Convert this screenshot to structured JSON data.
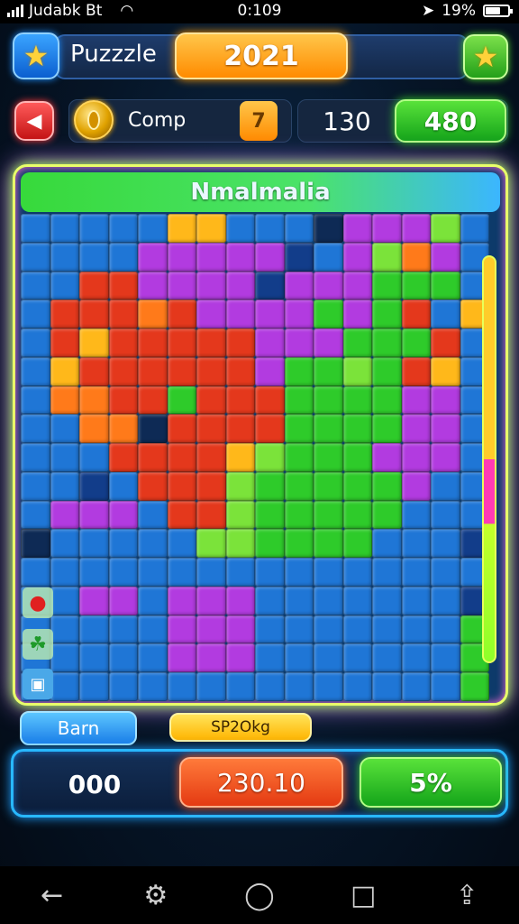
{
  "status": {
    "carrier": "Judabk Bt",
    "time": "0:109",
    "battery": "19%"
  },
  "header": {
    "title": "Puzzzle",
    "year": "2021"
  },
  "info": {
    "label": "Comp",
    "level": "7",
    "count": "130",
    "score": "480"
  },
  "board": {
    "title": "Nmalmalia",
    "palette": {
      "b": "#1f76d6",
      "d": "#123d8a",
      "p": "#b23be0",
      "r": "#e4381c",
      "o": "#ff7a1a",
      "y": "#ffb81a",
      "g": "#2ecb2a",
      "l": "#7be33a",
      "c": "#2aa7ff",
      "k": "#0e2a55"
    },
    "rows": [
      "bbbbbyybbbkppplb",
      "bbbbpppppdbplopb",
      "bbrrppppdpppgggb",
      "brrrorppppgpgrby",
      "bryrrrrrpppgggrb",
      "byrrrrrrpgglgryb",
      "boorrgrrrggggppb",
      "bbookrrrrggggppb",
      "bbbrrrrylgggpppb",
      "bbdbrrrlgggggpbb",
      "bpppbrrlgggggbbb",
      "kbbbbbllggggbbbd",
      "bbbbbbbbbbbbbbbb",
      "bbppbpppbbbbbbbd",
      "bbbbbpppbbbbbbbg",
      "bbbbbpppbbbbbbbg",
      "bbbbbbbbbbbbbbbg"
    ]
  },
  "labels": {
    "left": "Barn",
    "right": "SP2Okg"
  },
  "stats": {
    "v1": "000",
    "v2": "230.10",
    "v3": "5%"
  }
}
